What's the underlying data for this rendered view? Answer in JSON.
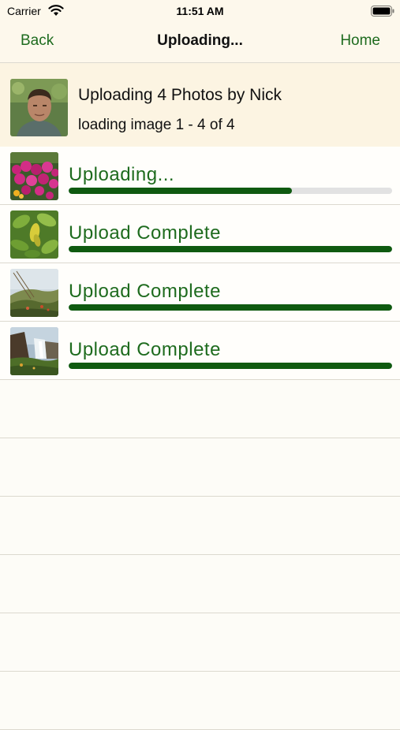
{
  "status_bar": {
    "carrier": "Carrier",
    "time": "11:51 AM"
  },
  "nav": {
    "back_label": "Back",
    "title": "Uploading...",
    "home_label": "Home"
  },
  "header": {
    "title": "Uploading 4 Photos by Nick",
    "subtitle": "loading image 1 - 4 of 4"
  },
  "uploads": [
    {
      "status": "Uploading...",
      "progress": 0.69,
      "thumbnail": "magenta-flowers-photo"
    },
    {
      "status": "Upload Complete",
      "progress": 1.0,
      "thumbnail": "green-leaves-photo"
    },
    {
      "status": "Upload Complete",
      "progress": 1.0,
      "thumbnail": "hillside-grass-photo"
    },
    {
      "status": "Upload Complete",
      "progress": 1.0,
      "thumbnail": "waterfall-photo"
    }
  ],
  "colors": {
    "accent": "#1e6b1e",
    "progress_fill": "#0f5a10",
    "progress_track": "#e2e2e2",
    "header_bg": "#fcf4e2"
  }
}
